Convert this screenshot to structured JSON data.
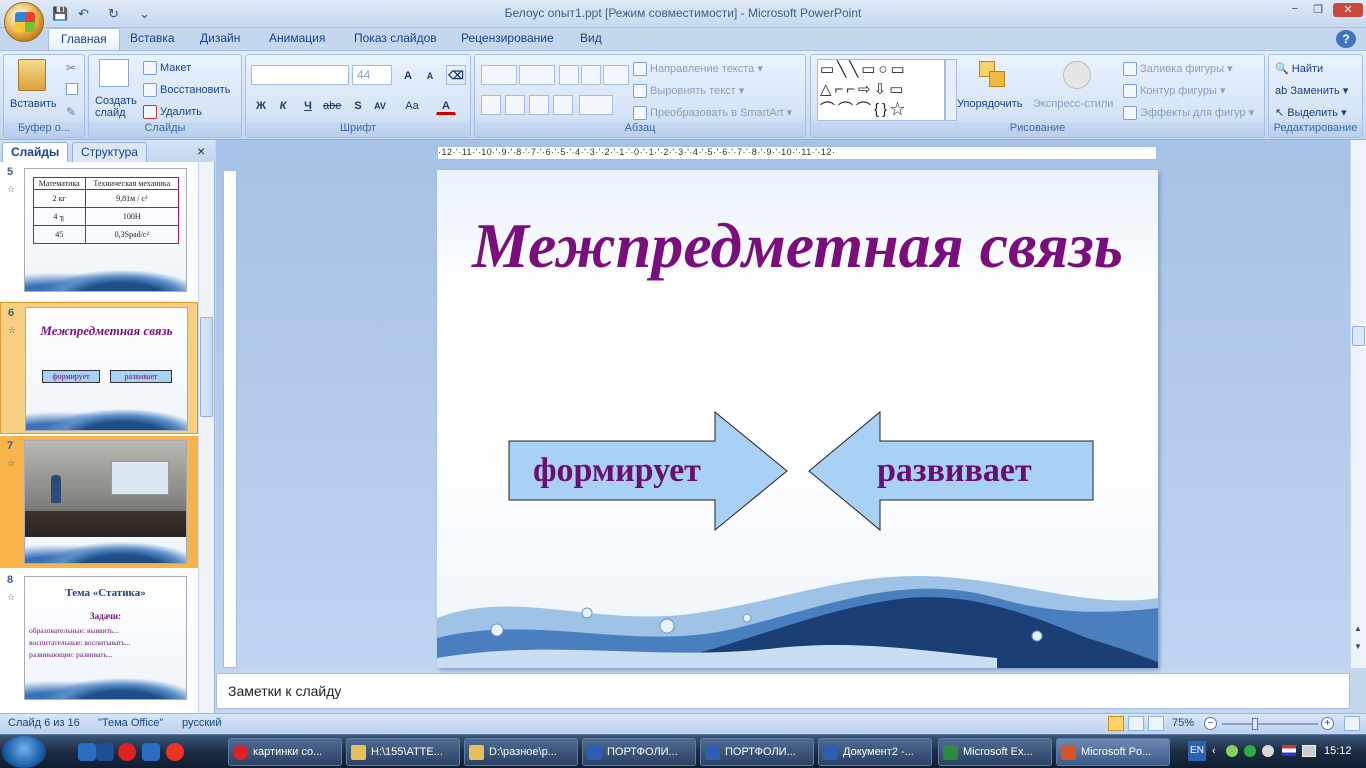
{
  "window": {
    "title": "Белоус опыт1.ppt [Режим совместимости] - Microsoft PowerPoint",
    "controls": {
      "minimize": "−",
      "maximize": "❐",
      "close": "✕"
    }
  },
  "quick_access": {
    "save": "💾",
    "undo": "↶",
    "redo": "↻",
    "customize": "⌄"
  },
  "tabs": [
    "Главная",
    "Вставка",
    "Дизайн",
    "Анимация",
    "Показ слайдов",
    "Рецензирование",
    "Вид"
  ],
  "active_tab": "Главная",
  "help": "?",
  "ribbon": {
    "clipboard": {
      "label": "Буфер о...",
      "paste": "Вставить"
    },
    "slides": {
      "label": "Слайды",
      "new_slide": "Создать слайд",
      "layout": "Макет",
      "reset": "Восстановить",
      "delete": "Удалить"
    },
    "font": {
      "label": "Шрифт",
      "font_name": "",
      "font_size": "44",
      "bold": "Ж",
      "italic": "К",
      "underline": "Ч",
      "strike": "abe",
      "shadow": "S",
      "spacing": "AV",
      "case": "Aa",
      "color": "A",
      "grow": "A",
      "shrink": "A"
    },
    "paragraph": {
      "label": "Абзац",
      "text_direction": "Направление текста",
      "align_text": "Выровнять текст",
      "smartart": "Преобразовать в SmartArt"
    },
    "drawing": {
      "label": "Рисование",
      "arrange": "Упорядочить",
      "quick_styles": "Экспресс-стили",
      "fill": "Заливка фигуры",
      "outline": "Контур фигуры",
      "effects": "Эффекты для фигур"
    },
    "editing": {
      "label": "Редактирование",
      "find": "Найти",
      "replace": "Заменить",
      "select": "Выделить"
    }
  },
  "left_panel": {
    "tab_slides": "Слайды",
    "tab_outline": "Структура",
    "close": "×",
    "slides": [
      {
        "number": "5",
        "table_headers": [
          "Математика",
          "Техническая механика"
        ],
        "rows": [
          [
            "2 кг",
            "9,81м / с²"
          ],
          [
            "4 ╖",
            "100Н"
          ],
          [
            "45",
            "0,3Spad/c²"
          ]
        ]
      },
      {
        "number": "6",
        "title": "Межпредметная связь",
        "left": "формирует",
        "right": "развивает"
      },
      {
        "number": "7",
        "caption": ""
      },
      {
        "number": "8",
        "title": "Тема «Статика»",
        "subtitle": "Задачи:",
        "lines": [
          "образовательные: выявить...",
          "воспитательные: воспитывать...",
          "развивающие: развивать..."
        ]
      }
    ]
  },
  "ruler": {
    "horizontal": "·12·'·11·'·10·'·9·'·8·'·7·'·6·'·5·'·4·'·3·'·2·'·1·'·0·'·1·'·2·'·3·'·4·'·5·'·6·'·7·'·8·'·9·'·10·'·11·'·12·"
  },
  "slide": {
    "title": "Межпредметная связь",
    "left_arrow_text": "формирует",
    "right_arrow_text": "развивает"
  },
  "notes_placeholder": "Заметки к слайду",
  "status": {
    "slide_info": "Слайд 6 из 16",
    "theme": "\"Тема Office\"",
    "language": "русский",
    "zoom": "75%"
  },
  "taskbar": {
    "tasks": [
      "картинки со...",
      "H:\\155\\АТТЕ...",
      "D:\\разное\\р...",
      "ПОРТФОЛИ...",
      "ПОРТФОЛИ...",
      "Документ2 -...",
      "Microsoft Ex...",
      "Microsoft Po..."
    ],
    "language": "EN",
    "time": "15:12"
  }
}
